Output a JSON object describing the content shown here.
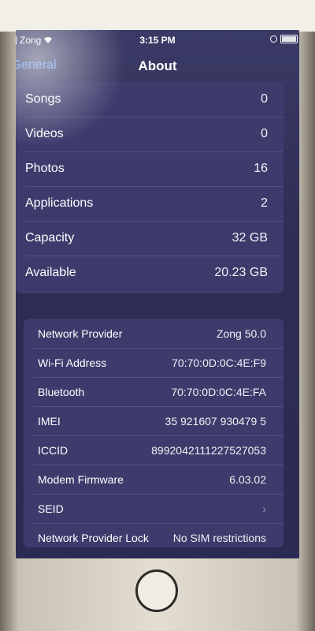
{
  "status_bar": {
    "carrier": "Zong",
    "time": "3:15 PM"
  },
  "nav": {
    "back_label": "General",
    "title": "About"
  },
  "group1": [
    {
      "label": "Songs",
      "value": "0"
    },
    {
      "label": "Videos",
      "value": "0"
    },
    {
      "label": "Photos",
      "value": "16"
    },
    {
      "label": "Applications",
      "value": "2"
    },
    {
      "label": "Capacity",
      "value": "32 GB"
    },
    {
      "label": "Available",
      "value": "20.23 GB"
    }
  ],
  "group2": [
    {
      "label": "Network Provider",
      "value": "Zong 50.0"
    },
    {
      "label": "Wi-Fi Address",
      "value": "70:70:0D:0C:4E:F9"
    },
    {
      "label": "Bluetooth",
      "value": "70:70:0D:0C:4E:FA"
    },
    {
      "label": "IMEI",
      "value": "35 921607 930479 5"
    },
    {
      "label": "ICCID",
      "value": "8992042111227527053"
    },
    {
      "label": "Modem Firmware",
      "value": "6.03.02"
    },
    {
      "label": "SEID",
      "value": ""
    },
    {
      "label": "Network Provider Lock",
      "value": "No SIM restrictions"
    }
  ],
  "icons": {
    "back": "chevron-left-icon",
    "disclosure": "chevron-right-icon"
  },
  "colors": {
    "accent": "#5e9bff",
    "screen_bg": "#2e2d55",
    "group_bg": "#3c3b6c"
  }
}
